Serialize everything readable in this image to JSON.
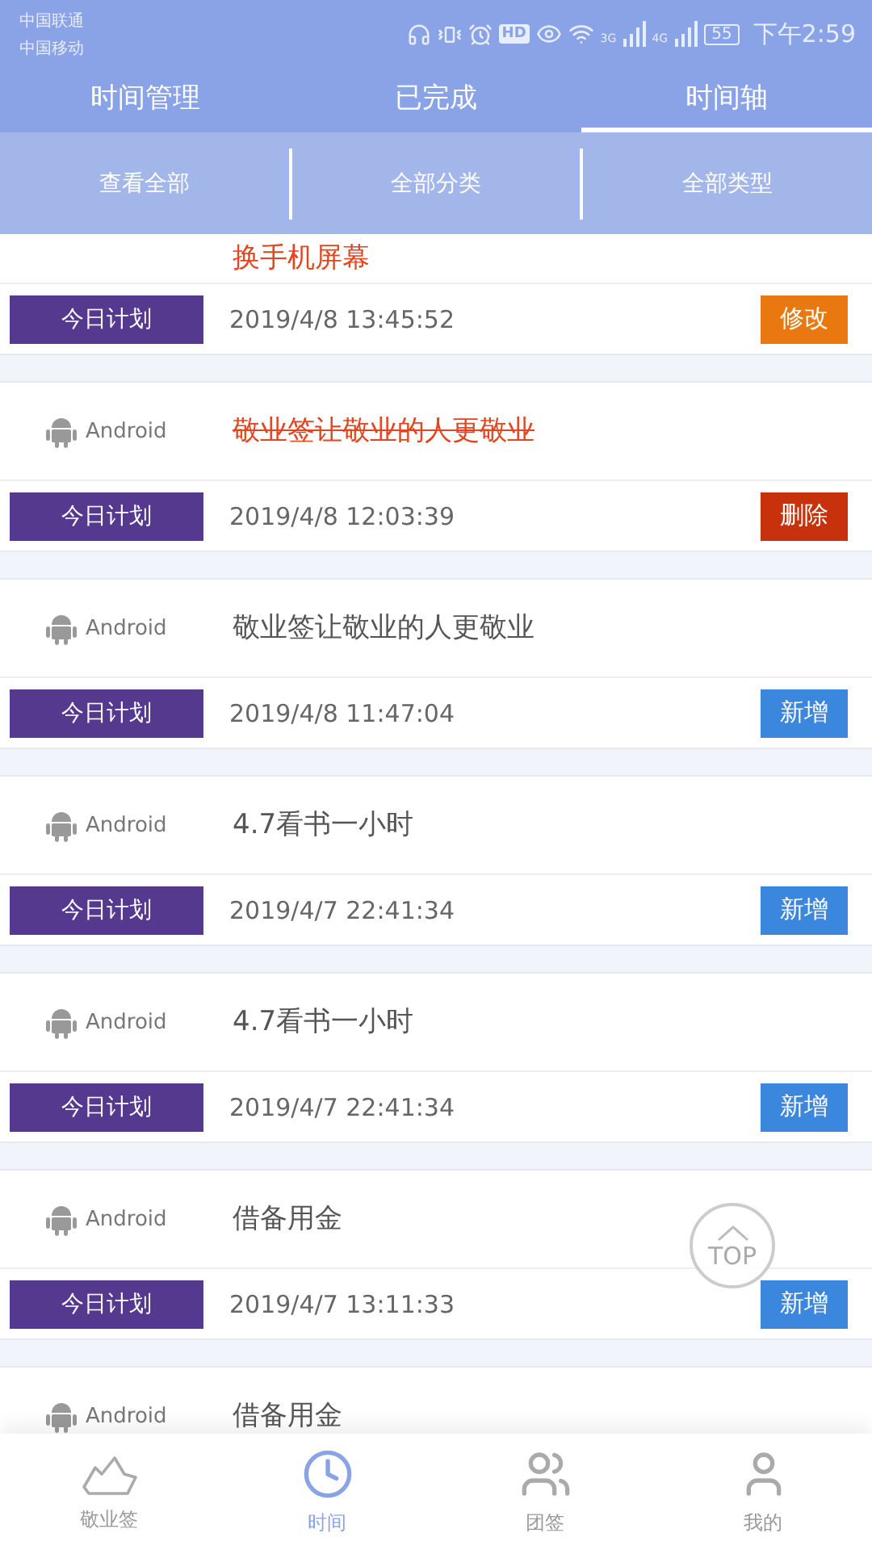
{
  "status_bar": {
    "carriers": [
      "中国联通",
      "中国移动"
    ],
    "network_labels": [
      "3G",
      "4G"
    ],
    "hd": "HD",
    "battery": "55",
    "time": "下午2:59"
  },
  "tabs": [
    {
      "label": "时间管理",
      "selected": false
    },
    {
      "label": "已完成",
      "selected": false
    },
    {
      "label": "时间轴",
      "selected": true
    }
  ],
  "filters": [
    "查看全部",
    "全部分类",
    "全部类型"
  ],
  "entries": [
    {
      "kind": "modify",
      "title": "换手机屏幕",
      "tag": "今日计划",
      "time": "2019/4/8  13:45:52",
      "action": "修改"
    },
    {
      "kind": "delete",
      "platform": "Android",
      "title": "敬业签让敬业的人更敬业",
      "tag": "今日计划",
      "time": "2019/4/8  12:03:39",
      "action": "删除"
    },
    {
      "kind": "add",
      "platform": "Android",
      "title": "敬业签让敬业的人更敬业",
      "tag": "今日计划",
      "time": "2019/4/8  11:47:04",
      "action": "新增"
    },
    {
      "kind": "add",
      "platform": "Android",
      "title": "4.7看书一小时",
      "tag": "今日计划",
      "time": "2019/4/7  22:41:34",
      "action": "新增"
    },
    {
      "kind": "add",
      "platform": "Android",
      "title": "4.7看书一小时",
      "tag": "今日计划",
      "time": "2019/4/7  22:41:34",
      "action": "新增"
    },
    {
      "kind": "add",
      "platform": "Android",
      "title": "借备用金",
      "tag": "今日计划",
      "time": "2019/4/7  13:11:33",
      "action": "新增"
    },
    {
      "kind": "add",
      "platform": "Android",
      "title": "借备用金"
    }
  ],
  "top_button": "TOP",
  "bottom_nav": [
    {
      "label": "敬业签",
      "selected": false
    },
    {
      "label": "时间",
      "selected": true
    },
    {
      "label": "团签",
      "selected": false
    },
    {
      "label": "我的",
      "selected": false
    }
  ]
}
